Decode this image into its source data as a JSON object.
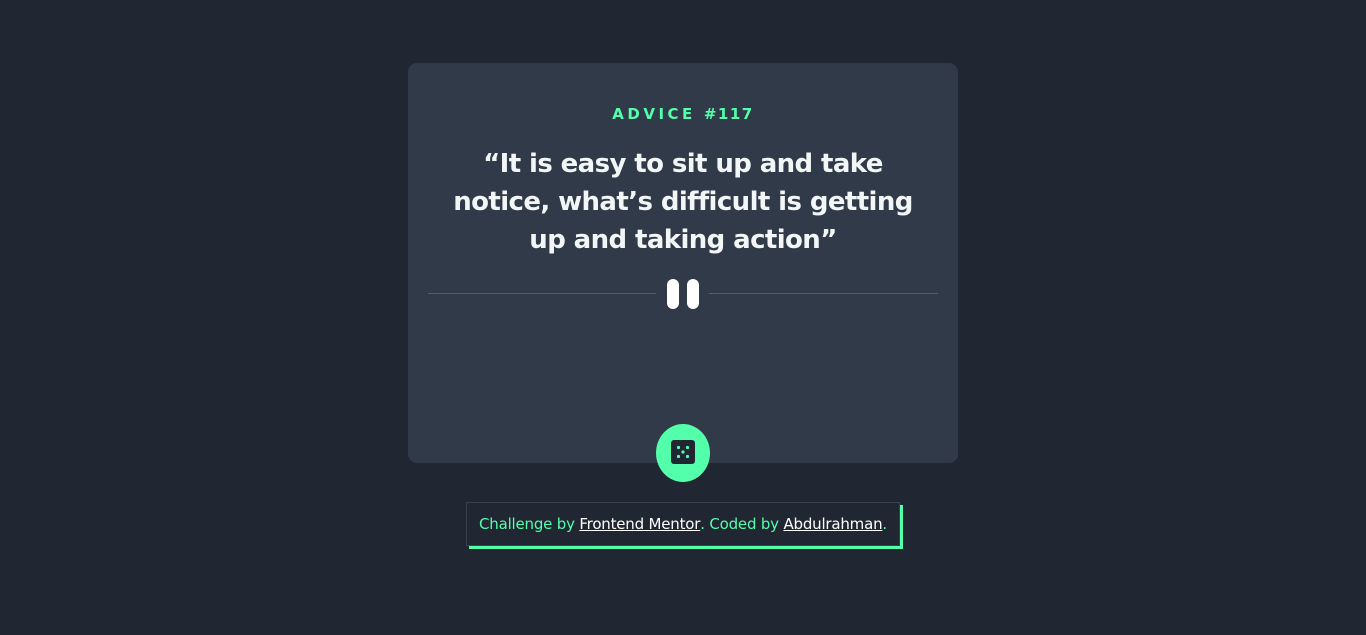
{
  "card": {
    "advice_label": "ADVICE",
    "advice_number": "#117",
    "quote": "“It is easy to sit up and take notice, what’s difficult is getting up and taking action”"
  },
  "dice_button": {
    "icon": "dice-icon"
  },
  "footer": {
    "prefix": "Challenge by ",
    "link1": "Frontend Mentor",
    "middle": ". Coded by ",
    "link2": "Abdulrahman",
    "suffix": "."
  },
  "colors": {
    "background": "#202632",
    "card": "#313a48",
    "accent": "#53ffaa",
    "text": "#ffffff",
    "divider": "#4f5d74"
  }
}
